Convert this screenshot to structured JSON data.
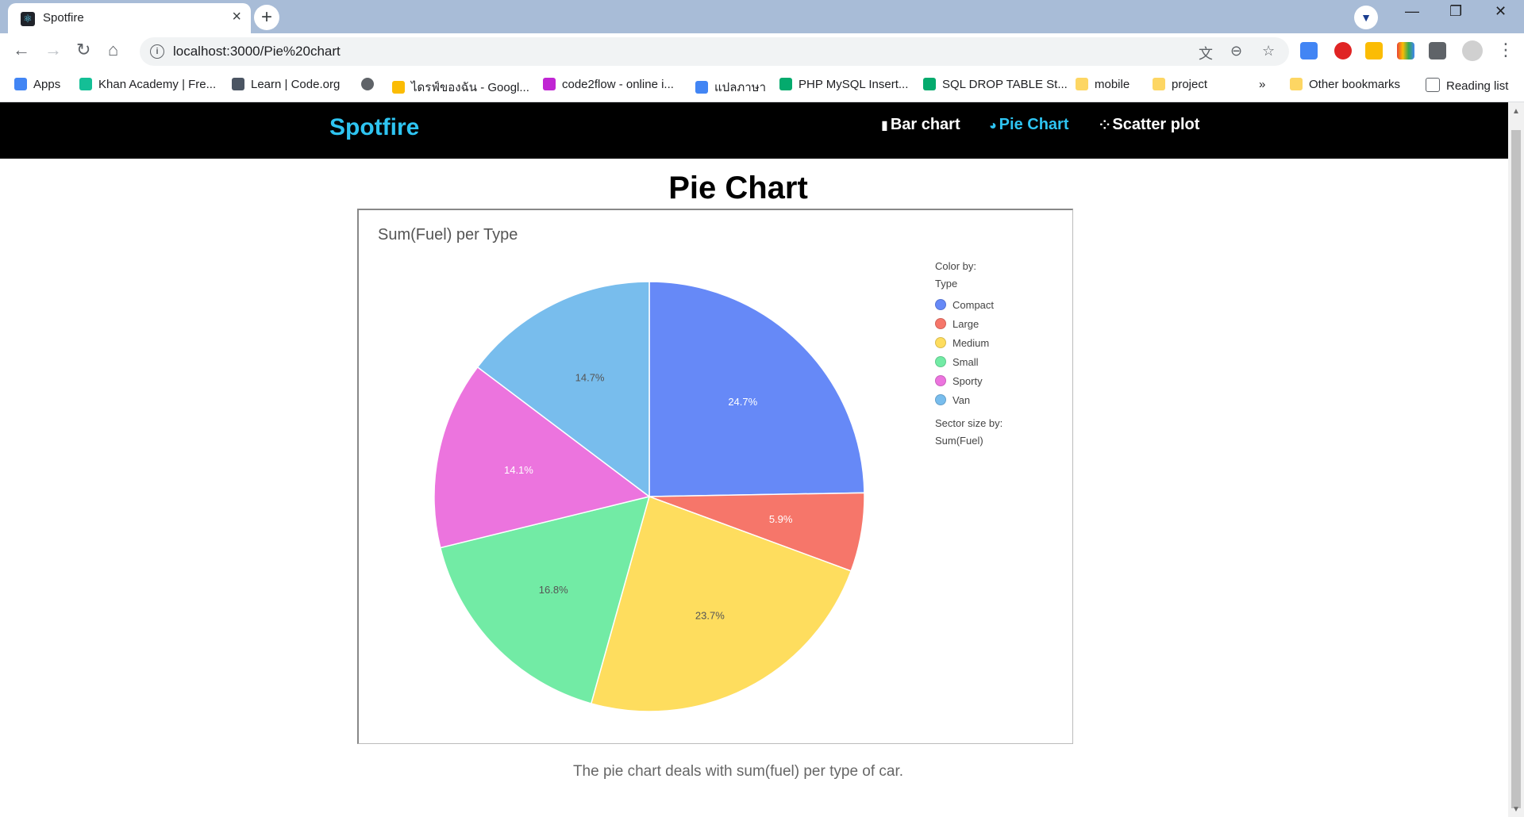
{
  "browser": {
    "tab_title": "Spotfire",
    "url": "localhost:3000/Pie%20chart",
    "bookmarks": [
      {
        "label": "Apps",
        "color": "#4285f4"
      },
      {
        "label": "Khan Academy | Fre...",
        "color": "#14bf96"
      },
      {
        "label": "Learn | Code.org",
        "color": "#4b5563"
      },
      {
        "label": "",
        "color": "#5f6368"
      },
      {
        "label": "ไดรฟ์ของฉัน - Googl...",
        "color": "#fbbc04"
      },
      {
        "label": "code2flow - online i...",
        "color": "#c026d3"
      },
      {
        "label": "แปลภาษา",
        "color": "#4285f4"
      },
      {
        "label": "PHP MySQL Insert...",
        "color": "#04aa6d"
      },
      {
        "label": "SQL DROP TABLE St...",
        "color": "#04aa6d"
      },
      {
        "label": "mobile",
        "color": "#fdd663"
      },
      {
        "label": "project",
        "color": "#fdd663"
      }
    ],
    "more_bookmarks": "»",
    "other_bookmarks": "Other bookmarks",
    "reading_list": "Reading list"
  },
  "nav": {
    "brand": "Spotfire",
    "links": [
      {
        "label": "Bar chart",
        "icon": "bar-chart-icon"
      },
      {
        "label": "Pie Chart",
        "icon": "pie-chart-icon"
      },
      {
        "label": "Scatter plot",
        "icon": "scatter-plot-icon"
      }
    ]
  },
  "page": {
    "title": "Pie Chart",
    "caption": "The pie chart deals with sum(fuel) per type of car."
  },
  "legend": {
    "color_by_label": "Color by:",
    "color_by_value": "Type",
    "sector_size_label": "Sector size by:",
    "sector_size_value": "Sum(Fuel)"
  },
  "chart_data": {
    "type": "pie",
    "title": "Sum(Fuel) per Type",
    "categories": [
      "Compact",
      "Large",
      "Medium",
      "Small",
      "Sporty",
      "Van"
    ],
    "values": [
      24.7,
      5.9,
      23.7,
      16.8,
      14.1,
      14.7
    ],
    "labels": [
      "24.7%",
      "5.9%",
      "23.7%",
      "16.8%",
      "14.1%",
      "14.7%"
    ],
    "colors": [
      "#6689f7",
      "#f6766a",
      "#fedd5e",
      "#72eba5",
      "#ec74de",
      "#78bded"
    ],
    "legend_position": "right"
  }
}
